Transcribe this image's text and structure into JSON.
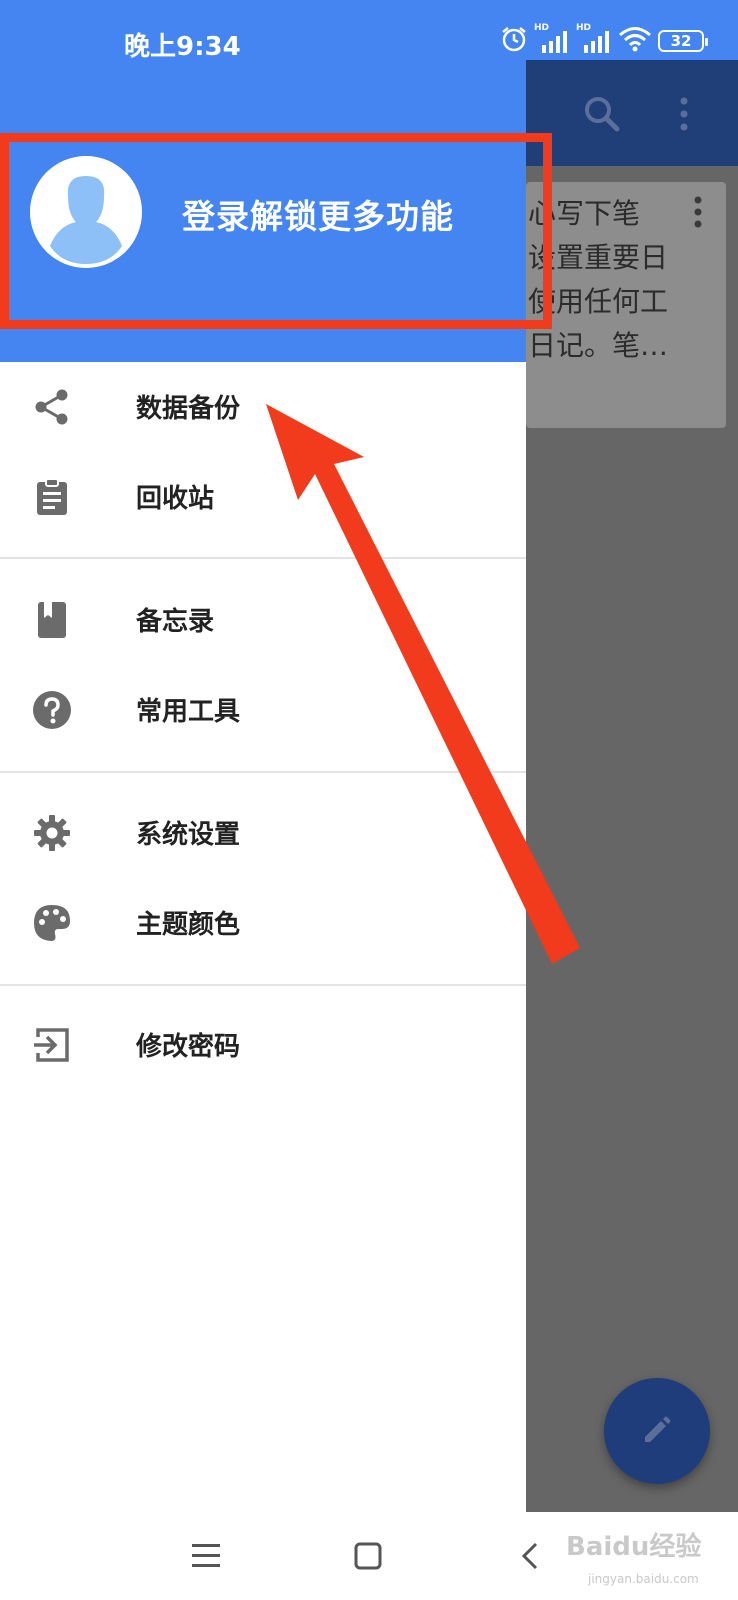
{
  "status_bar": {
    "time": "晚上9:34",
    "network_label_1": "HD",
    "network_label_2": "HD",
    "battery": "32"
  },
  "background_app": {
    "toolbar_color": "#203e78",
    "note_preview": "心写下笔\n设置重要日\n使用任何工\n日记。笔…",
    "fab_icon": "pencil-icon"
  },
  "drawer": {
    "header_color": "#4585f2",
    "login_prompt": "登录解锁更多功能",
    "menu_groups": [
      [
        {
          "label": "数据备份",
          "icon": "share-icon"
        },
        {
          "label": "回收站",
          "icon": "clipboard-icon"
        }
      ],
      [
        {
          "label": "备忘录",
          "icon": "book-icon"
        },
        {
          "label": "常用工具",
          "icon": "help-icon"
        }
      ],
      [
        {
          "label": "系统设置",
          "icon": "gear-icon"
        },
        {
          "label": "主题颜色",
          "icon": "palette-icon"
        }
      ],
      [
        {
          "label": "修改密码",
          "icon": "login-icon"
        }
      ]
    ]
  },
  "annotation": {
    "color": "#f23a1c"
  },
  "nav_bar": {
    "menu_icon": "menu-icon",
    "home_icon": "home-icon",
    "back_icon": "back-icon"
  },
  "watermark": {
    "text": "Baidu经验",
    "sub": "jingyan.baidu.com"
  }
}
